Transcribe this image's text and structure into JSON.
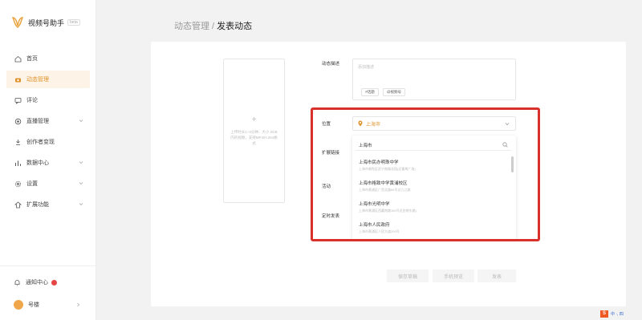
{
  "app": {
    "title": "视频号助手",
    "badge": "beta"
  },
  "sidebar": {
    "items": [
      {
        "label": "首页",
        "icon": "home-icon",
        "active": false,
        "expandable": false
      },
      {
        "label": "动态管理",
        "icon": "camera-icon",
        "active": true,
        "expandable": false
      },
      {
        "label": "评论",
        "icon": "comment-icon",
        "active": false,
        "expandable": false
      },
      {
        "label": "直播管理",
        "icon": "live-icon",
        "active": false,
        "expandable": true
      },
      {
        "label": "创作者变现",
        "icon": "monetize-icon",
        "active": false,
        "expandable": false
      },
      {
        "label": "数据中心",
        "icon": "chart-icon",
        "active": false,
        "expandable": true
      },
      {
        "label": "设置",
        "icon": "gear-icon",
        "active": false,
        "expandable": true
      },
      {
        "label": "扩展功能",
        "icon": "extension-icon",
        "active": false,
        "expandable": true
      }
    ],
    "bottom": {
      "notifications_label": "通知中心",
      "account_label": "号楼"
    }
  },
  "breadcrumb": {
    "parent": "动态管理",
    "separator": " / ",
    "current": "发表动态"
  },
  "form": {
    "upload_hint": "上传时长1~3分钟、大小 2GB 内的视频，支持MP4/H.264格式",
    "desc_label": "动态描述",
    "desc_placeholder": "添加描述",
    "chips": [
      "#话题",
      "@视频号"
    ],
    "location_label": "位置",
    "location_value": "上海市",
    "extension_label": "扩展链接",
    "activity_label": "活动",
    "schedule_label": "定时发表"
  },
  "location_dropdown": {
    "search_value": "上海市",
    "results": [
      {
        "name": "上海市民办明珠中学",
        "addr": "上海市普陀区武宁南路北段(近番禺广场)"
      },
      {
        "name": "上海市格致中学黄浦校区",
        "addr": "上海市黄浦区广西北路66号近九江路"
      },
      {
        "name": "上海市光明中学",
        "addr": "上海市黄浦区西藏南路160号近金陵东路)"
      },
      {
        "name": "上海市人民政府",
        "addr": "上海市黄浦区人民大道200号"
      }
    ]
  },
  "buttons": {
    "save_draft": "保存草稿",
    "preview": "手机预览",
    "publish": "发表"
  },
  "watermark": {
    "text": "中 ·, 四"
  },
  "colors": {
    "accent": "#e0922a",
    "highlight_box": "#d9302c",
    "active_bg": "#fdf3e6"
  }
}
